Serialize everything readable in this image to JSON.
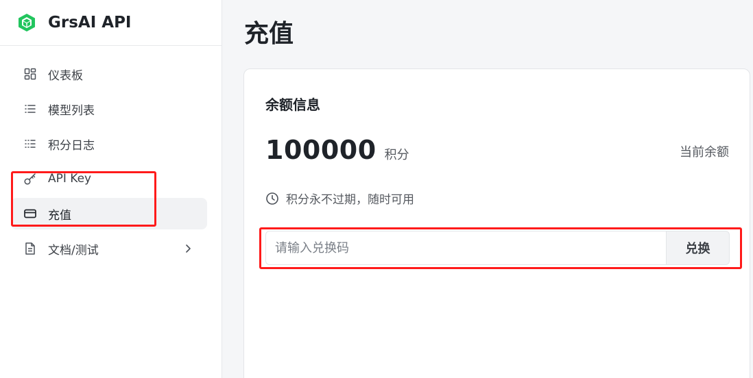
{
  "brand": {
    "name": "GrsAI API",
    "logo_icon": "cube-logo-icon",
    "logo_color": "#22c55e"
  },
  "sidebar": {
    "items": [
      {
        "label": "仪表板",
        "icon": "grid-icon"
      },
      {
        "label": "模型列表",
        "icon": "list-icon"
      },
      {
        "label": "积分日志",
        "icon": "list-detail-icon"
      },
      {
        "label": "API Key",
        "icon": "key-icon"
      },
      {
        "label": "充值",
        "icon": "credit-card-icon",
        "active": true
      },
      {
        "label": "文档/测试",
        "icon": "document-icon",
        "has_submenu": true
      }
    ]
  },
  "main": {
    "title": "充值",
    "card": {
      "title": "余额信息",
      "balance_value": "100000",
      "balance_unit": "积分",
      "current_label": "当前余额",
      "note": "积分永不过期，随时可用",
      "redeem_placeholder": "请输入兑换码",
      "redeem_button": "兑换"
    }
  },
  "annotations": {
    "highlight_color": "#ff1a1a"
  }
}
